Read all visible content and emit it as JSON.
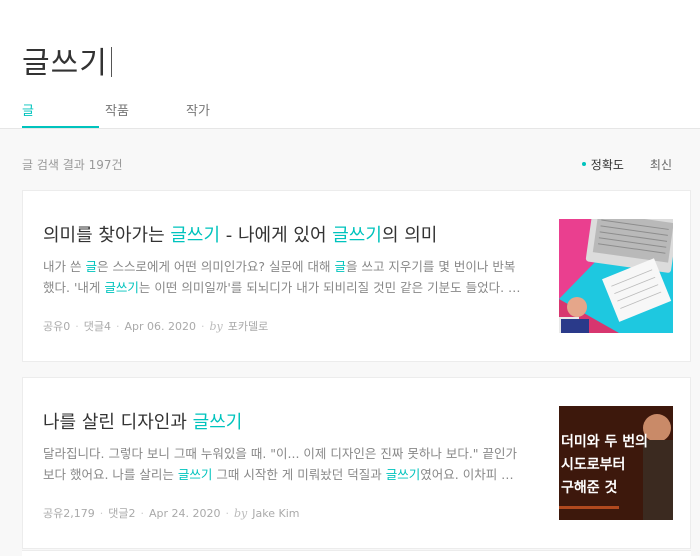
{
  "header": {
    "search_query": "글쓰기",
    "tabs": [
      {
        "label": "글",
        "active": true
      },
      {
        "label": "작품",
        "active": false
      },
      {
        "label": "작가",
        "active": false
      }
    ]
  },
  "results": {
    "summary": "글 검색 결과 197건",
    "sort_options": [
      {
        "label": "정확도",
        "active": true
      },
      {
        "label": "최신",
        "active": false
      }
    ]
  },
  "articles": [
    {
      "title": {
        "pre": "의미를 찾아가는 ",
        "hl1": "글쓰기",
        "mid": " - 나에게 있어 ",
        "hl2": "글쓰기",
        "post": "의 의미"
      },
      "excerpt_line1": {
        "pre": "내가 쓴 ",
        "hl1": "글",
        "mid": "은 스스로에게 어떤 의미인가요? 실문에 대해 ",
        "hl2": "글",
        "post": "을 쓰고 지우기를 몇 번이나 반복"
      },
      "excerpt_line2": {
        "pre": "했다. '내게 ",
        "hl1": "글쓰기",
        "post": "는 이떤 의미일까'를 되뇌디가 내가 되비리질 것민 같은 기분도 들었다. …"
      },
      "meta": {
        "shares": "공유0",
        "comments": "댓글4",
        "date": "Apr 06. 2020",
        "by": "by",
        "author": "포카델로"
      },
      "thumbnail": "photo-laptop-notebook"
    },
    {
      "title": {
        "pre": "나를 살린 디자인과 ",
        "hl1": "글쓰기"
      },
      "excerpt_line1": {
        "pre": "달라집니다. 그렇다 보니 그때 누워있을 때. \"이... 이제 디자인은 진짜 못하나 보다.\" 끝인가"
      },
      "excerpt_line2": {
        "pre": "보다 했어요. 나를 살리는 ",
        "hl1": "글쓰기",
        "mid": " 그때 시작한 게 미뤄놨던 덕질과 ",
        "hl2": "글쓰기",
        "post": "였어요. 이차피 …"
      },
      "meta": {
        "shares": "공유2,179",
        "comments": "댓글2",
        "date": "Apr 24. 2020",
        "by": "by",
        "author": "Jake Kim"
      },
      "thumbnail": {
        "line1": "더미와 두 번의",
        "line2": "시도로부터",
        "line3": "구해준 것"
      }
    }
  ],
  "colors": {
    "accent": "#00c3bd",
    "thumb1_pink": "#ea3f8f",
    "thumb1_cyan": "#1ec8e0",
    "thumb2_bg": "#1d0f0a"
  }
}
